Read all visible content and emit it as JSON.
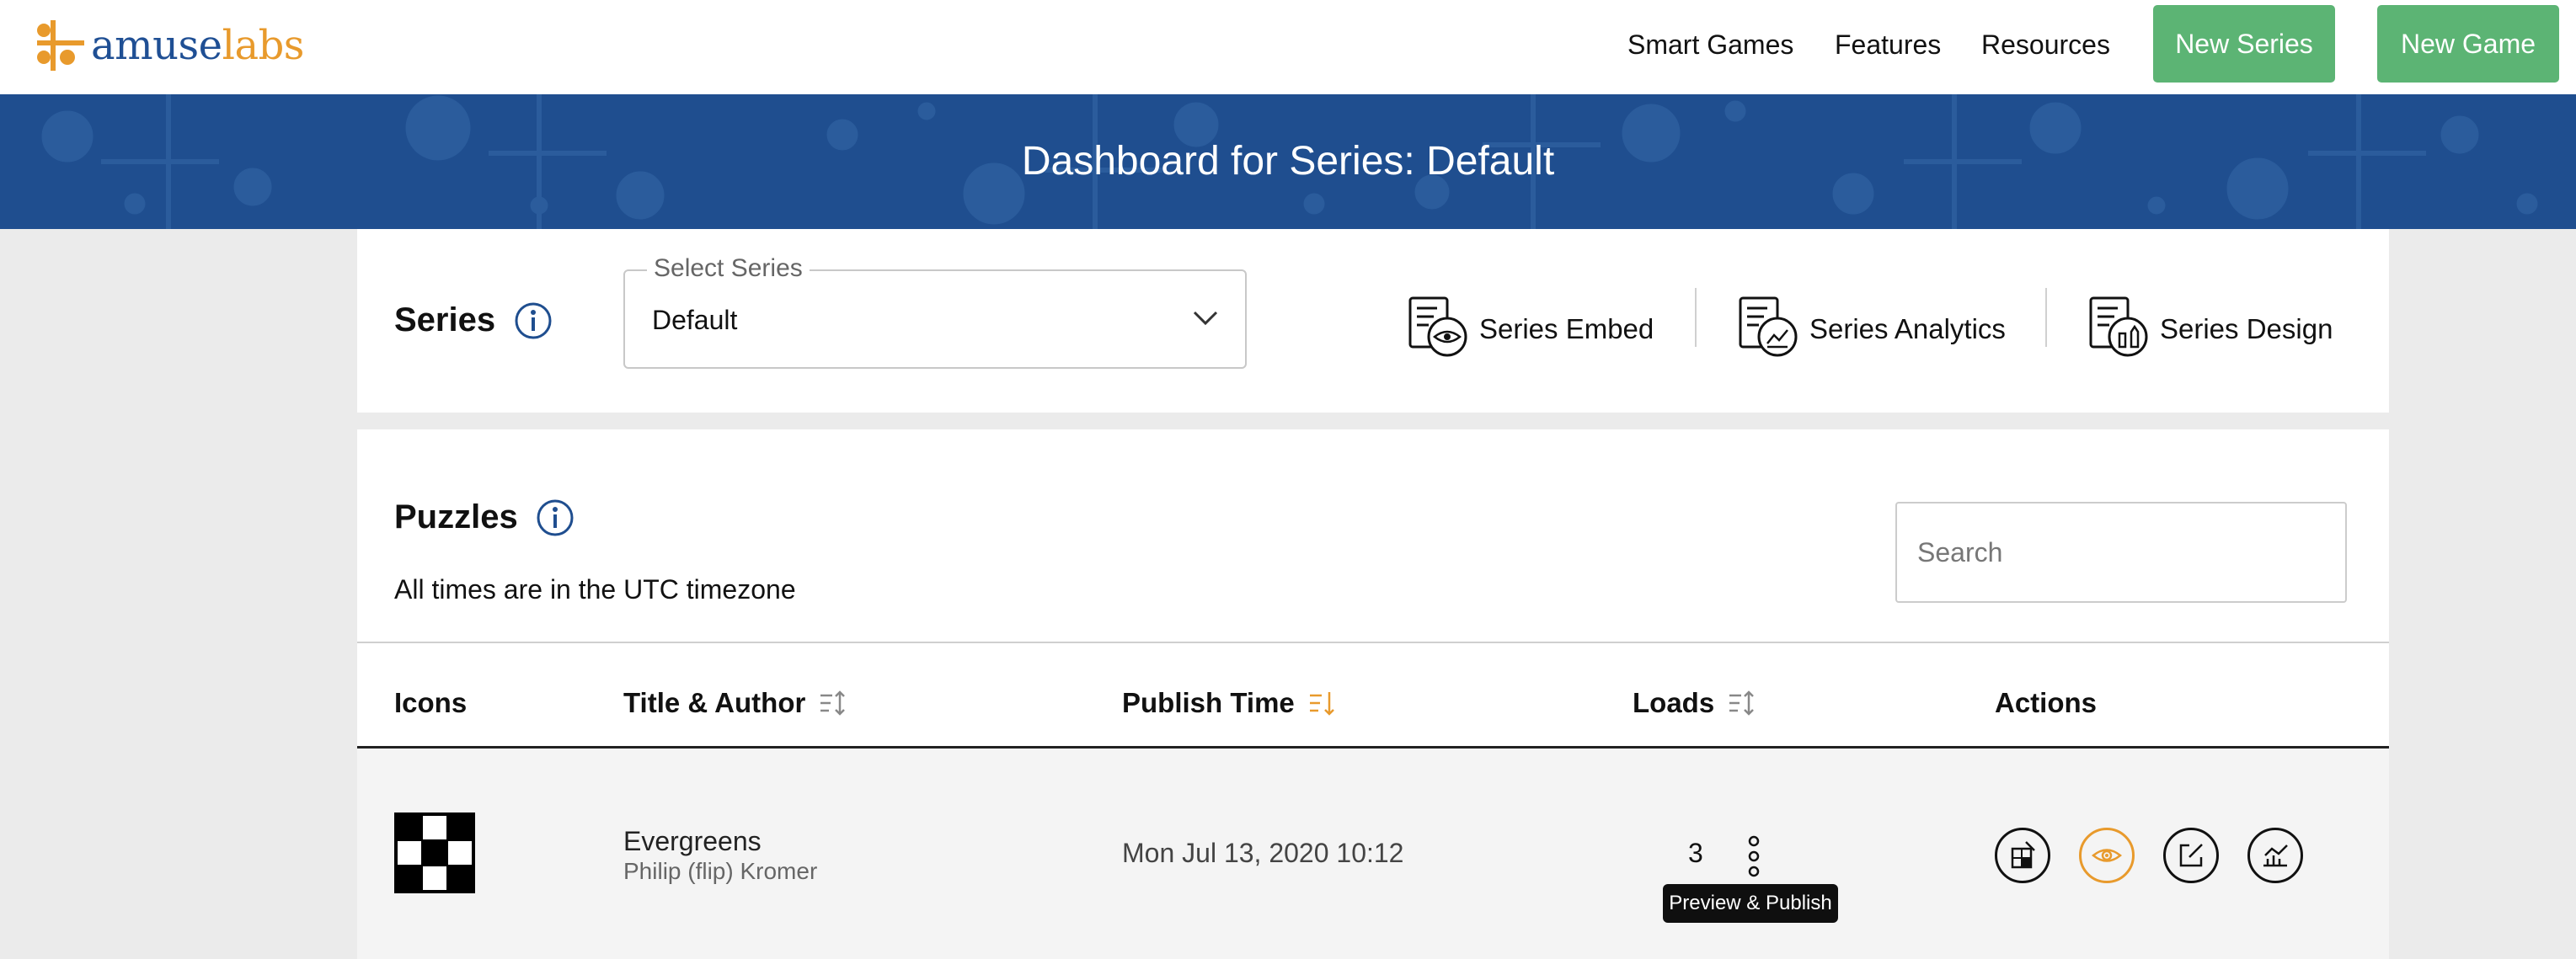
{
  "brand": {
    "logo_part1": "amuse",
    "logo_part2": "labs"
  },
  "nav": {
    "links": [
      "Smart Games",
      "Features",
      "Resources"
    ],
    "new_series": "New Series",
    "new_game": "New Game"
  },
  "banner": {
    "title": "Dashboard for Series: Default"
  },
  "series_panel": {
    "heading": "Series",
    "select_legend": "Select Series",
    "select_value": "Default",
    "actions": [
      "Series Embed",
      "Series Analytics",
      "Series Design"
    ]
  },
  "puzzles_panel": {
    "heading": "Puzzles",
    "timezone_note": "All times are in the UTC timezone",
    "search_placeholder": "Search",
    "columns": [
      "Icons",
      "Title & Author",
      "Publish Time",
      "Loads",
      "Actions"
    ],
    "rows": [
      {
        "title": "Evergreens",
        "author": "Philip (flip) Kromer",
        "publish_time": "Mon Jul 13, 2020 10:12",
        "loads": "3"
      }
    ],
    "tooltip": "Preview & Publish"
  },
  "colors": {
    "brand_blue": "#1f4e8f",
    "brand_orange": "#e89a2c",
    "green": "#5cb474"
  },
  "icons": {
    "row_actions": [
      "crossword-edit-icon",
      "preview-eye-icon",
      "edit-icon",
      "analytics-chart-icon",
      "kebab-menu-icon"
    ]
  }
}
